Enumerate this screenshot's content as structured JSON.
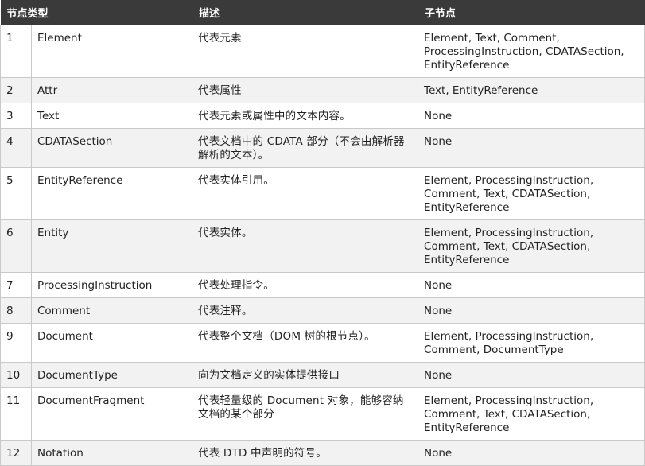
{
  "header": {
    "col_type": "节点类型",
    "col_desc": "描述",
    "col_children": "子节点"
  },
  "rows": [
    {
      "num": "1",
      "type": "Element",
      "desc": "代表元素",
      "children": "Element, Text, Comment, ProcessingInstruction, CDATASection, EntityReference"
    },
    {
      "num": "2",
      "type": "Attr",
      "desc": "代表属性",
      "children": "Text, EntityReference"
    },
    {
      "num": "3",
      "type": "Text",
      "desc": "代表元素或属性中的文本内容。",
      "children": "None"
    },
    {
      "num": "4",
      "type": "CDATASection",
      "desc": "代表文档中的 CDATA 部分（不会由解析器解析的文本）。",
      "children": "None"
    },
    {
      "num": "5",
      "type": "EntityReference",
      "desc": "代表实体引用。",
      "children": "Element, ProcessingInstruction, Comment, Text, CDATASection, EntityReference"
    },
    {
      "num": "6",
      "type": "Entity",
      "desc": "代表实体。",
      "children": "Element, ProcessingInstruction, Comment, Text, CDATASection, EntityReference"
    },
    {
      "num": "7",
      "type": "ProcessingInstruction",
      "desc": "代表处理指令。",
      "children": "None"
    },
    {
      "num": "8",
      "type": "Comment",
      "desc": "代表注释。",
      "children": "None"
    },
    {
      "num": "9",
      "type": "Document",
      "desc": "代表整个文档（DOM 树的根节点）。",
      "children": "Element, ProcessingInstruction, Comment, DocumentType"
    },
    {
      "num": "10",
      "type": "DocumentType",
      "desc": "向为文档定义的实体提供接口",
      "children": "None"
    },
    {
      "num": "11",
      "type": "DocumentFragment",
      "desc": "代表轻量级的 Document 对象，能够容纳文档的某个部分",
      "children": "Element, ProcessingInstruction, Comment, Text, CDATASection, EntityReference"
    },
    {
      "num": "12",
      "type": "Notation",
      "desc": "代表 DTD 中声明的符号。",
      "children": "None"
    }
  ]
}
